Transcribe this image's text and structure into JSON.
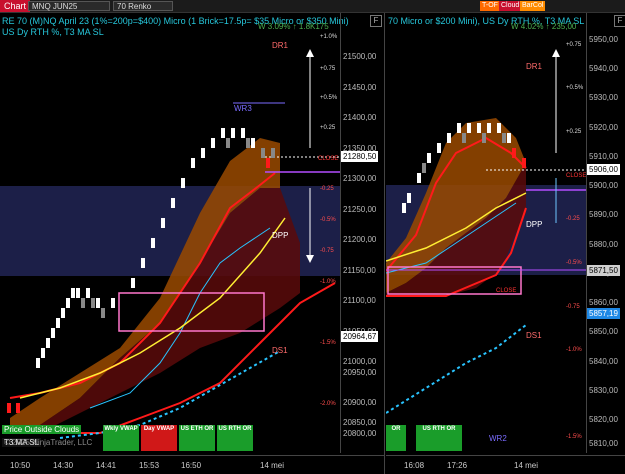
{
  "topbar": {
    "tab": "Chart",
    "instrument": "MNQ JUN25",
    "bar_type": "70 Renko",
    "buttons": [
      {
        "label": "T-OF",
        "color": "#ff6a00"
      },
      {
        "label": "Cloud",
        "color": "#c8102e"
      },
      {
        "label": "BarCol",
        "color": "#ff8c00"
      }
    ]
  },
  "left": {
    "info_line1": "RE 70 (M)NQ April 23 (1%=200p=$400) Micro (1 Brick=17.5p= $35 Micro or $350 Mini)",
    "info_line2": "US Dy RTH %, T3 MA SL",
    "pnl_label": "W 3.09% ↑ 1.8K175",
    "levels": {
      "dr1": "DR1",
      "wr3": "WR3",
      "dpp": "DPP",
      "ds1": "DS1",
      "close": "CLOSE"
    },
    "pct_labels": [
      "+1.0%",
      "+0.75",
      "+0.5%",
      "+0.25",
      "-0.25",
      "-0.5%",
      "-0.75",
      "-1.0%",
      "-1.5%",
      "-2.0%"
    ],
    "price_ticks": [
      "21500,00",
      "21450,00",
      "21400,00",
      "21350,00",
      "21300,00",
      "21250,00",
      "21200,00",
      "21150,00",
      "21100,00",
      "21050,00",
      "21000,00",
      "20950,00",
      "20900,00",
      "20850,00",
      "20800,00"
    ],
    "price_tag_current": "21280,50",
    "price_tag_low": "20964,67",
    "time_labels": [
      "10:50",
      "14:30",
      "14:41",
      "15:53",
      "16:50",
      "14 mei"
    ],
    "watermark": "© 2025 NinjaTrader, LLC",
    "note_top": "Price Outside Clouds",
    "note_bottom": "T3 MA SL",
    "buttons": [
      {
        "label": "Wkly VWAP",
        "color": "#1a9d2a"
      },
      {
        "label": "Day VWAP",
        "color": "#d01818"
      },
      {
        "label": "US ETH OR",
        "color": "#1a9d2a"
      },
      {
        "label": "US RTH OR",
        "color": "#1a9d2a"
      }
    ],
    "f_label": "F"
  },
  "right": {
    "info_line1": "70 Micro or $200 Mini), US Dy RTH %, T3 MA SL",
    "pnl_label": "W 4.02% ↑ 235,00",
    "levels": {
      "dr1": "DR1",
      "dpp": "DPP",
      "ds1": "DS1",
      "wr2": "WR2",
      "close": "CLOSE"
    },
    "pct_labels": [
      "+0.75",
      "+0.5%",
      "+0.25",
      "-0.25",
      "-0.5%",
      "-0.75",
      "-1.0%",
      "-1.5%"
    ],
    "price_ticks": [
      "5950,00",
      "5940,00",
      "5930,00",
      "5920,00",
      "5910,00",
      "5900,00",
      "5890,00",
      "5880,00",
      "5870,00",
      "5860,00",
      "5850,00",
      "5840,00",
      "5830,00",
      "5820,00",
      "5810,00"
    ],
    "price_tag_current": "5906,00",
    "price_tag_mid": "5871,50",
    "price_tag_low": "5857,19",
    "time_labels": [
      "16:08",
      "17:26",
      "14 mei"
    ],
    "buttons": [
      {
        "label": "OR",
        "color": "#1a9d2a"
      },
      {
        "label": "US RTH OR",
        "color": "#1a9d2a"
      }
    ],
    "f_label": "F"
  }
}
